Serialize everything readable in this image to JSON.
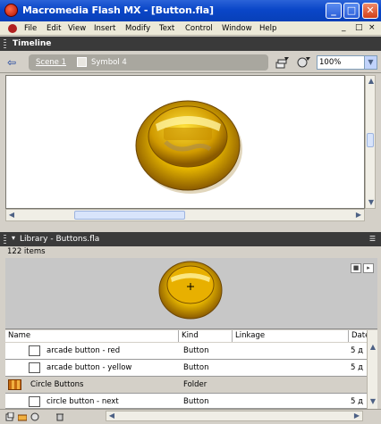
{
  "window": {
    "title": "Macromedia Flash MX - [Button.fla]",
    "controls": {
      "minimize": "_",
      "maximize": "□",
      "close": "✕"
    }
  },
  "menubar": {
    "items": [
      "File",
      "Edit",
      "View",
      "Insert",
      "Modify",
      "Text",
      "Control",
      "Window",
      "Help"
    ],
    "doc_controls": [
      "_",
      "□",
      "×"
    ]
  },
  "timeline": {
    "title": "Timeline"
  },
  "editbar": {
    "scene": "Scene 1",
    "symbol": "Symbol 4",
    "zoom": "100%"
  },
  "library": {
    "title": "Library - Buttons.fla",
    "item_count": "122 items",
    "columns": [
      "Name",
      "Kind",
      "Linkage",
      "Date"
    ],
    "rows": [
      {
        "name": "arcade button - red",
        "kind": "Button",
        "date": "5 д",
        "type": "symbol"
      },
      {
        "name": "arcade button - yellow",
        "kind": "Button",
        "date": "5 д",
        "type": "symbol"
      },
      {
        "name": "Circle Buttons",
        "kind": "Folder",
        "date": "",
        "type": "folder"
      },
      {
        "name": "circle button - next",
        "kind": "Button",
        "date": "5 д",
        "type": "symbol"
      }
    ]
  },
  "colors": {
    "titlebar": "#0a46c8",
    "panel_header": "#3a3a3a",
    "button_gold": "#e8b800",
    "folder_row": "#d4d0c8"
  }
}
